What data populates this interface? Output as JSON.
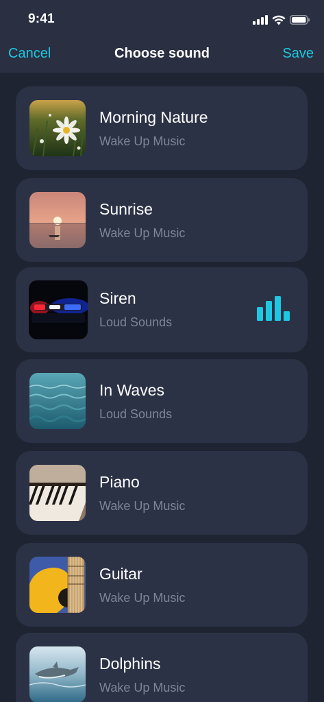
{
  "status": {
    "time": "9:41"
  },
  "nav": {
    "cancel_label": "Cancel",
    "title": "Choose sound",
    "save_label": "Save"
  },
  "accent_color": "#1ec8e3",
  "sounds": [
    {
      "title": "Morning Nature",
      "subtitle": "Wake Up Music",
      "image": "daisy-flower-photo",
      "selected": false
    },
    {
      "title": "Sunrise",
      "subtitle": "Wake Up Music",
      "image": "sunrise-over-sea-photo",
      "selected": false
    },
    {
      "title": "Siren",
      "subtitle": "Loud Sounds",
      "image": "police-siren-lights-photo",
      "selected": true
    },
    {
      "title": "In Waves",
      "subtitle": "Loud Sounds",
      "image": "ocean-waves-photo",
      "selected": false
    },
    {
      "title": "Piano",
      "subtitle": "Wake Up Music",
      "image": "piano-keys-photo",
      "selected": false
    },
    {
      "title": "Guitar",
      "subtitle": "Wake Up Music",
      "image": "acoustic-guitar-photo",
      "selected": false
    },
    {
      "title": "Dolphins",
      "subtitle": "Wake Up Music",
      "image": "dolphins-photo",
      "selected": false
    }
  ]
}
